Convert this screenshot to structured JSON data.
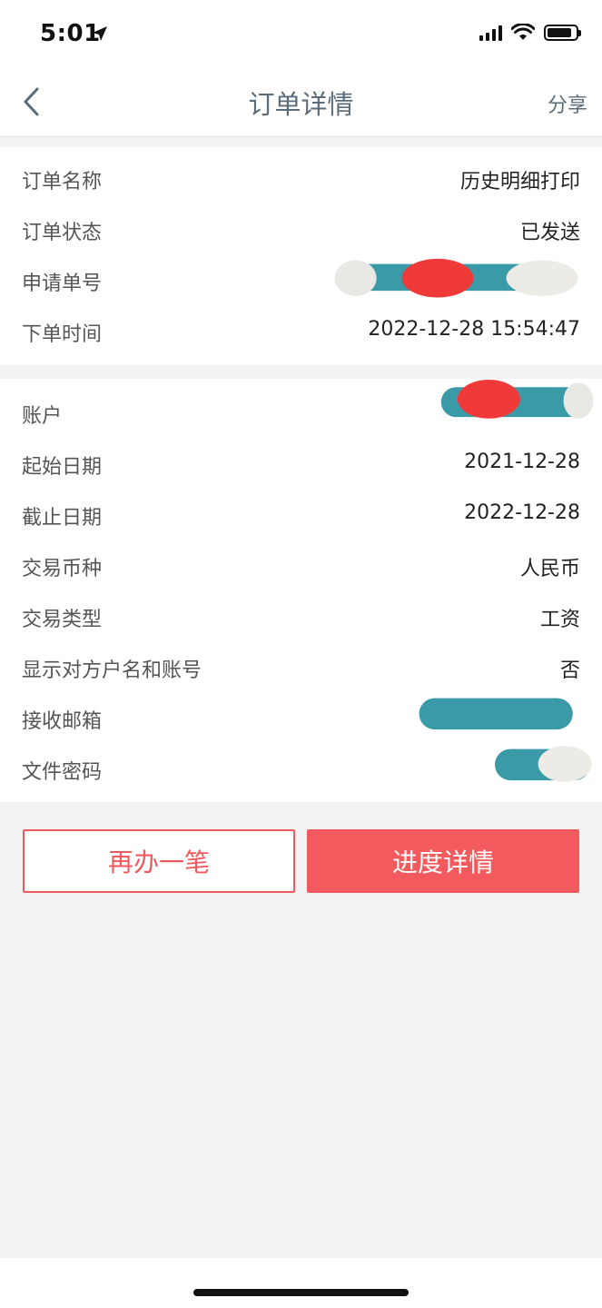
{
  "status_bar": {
    "time": "5:01",
    "location_icon": "location-arrow-icon",
    "signal_icon": "cellular-signal-icon",
    "wifi_icon": "wifi-icon",
    "battery_icon": "battery-icon"
  },
  "nav": {
    "back_icon": "chevron-left-icon",
    "title": "订单详情",
    "share_label": "分享"
  },
  "order_info": {
    "name_label": "订单名称",
    "name_value": "历史明细打印",
    "status_label": "订单状态",
    "status_value": "已发送",
    "apply_no_label": "申请单号",
    "time_label": "下单时间",
    "time_value": "2022-12-28 15:54:47"
  },
  "detail_info": {
    "account_label": "账户",
    "start_label": "起始日期",
    "start_value": "2021-12-28",
    "end_label": "截止日期",
    "end_value": "2022-12-28",
    "currency_label": "交易币种",
    "currency_value": "人民币",
    "type_label": "交易类型",
    "type_value": "工资",
    "show_counterparty_label": "显示对方户名和账号",
    "show_counterparty_value": "否",
    "email_label": "接收邮箱",
    "password_label": "文件密码"
  },
  "actions": {
    "redo_label": "再办一笔",
    "progress_label": "进度详情"
  },
  "colors": {
    "accent": "#f25a5d",
    "nav_text": "#5a6c7a",
    "redact_teal": "#3a9aa8",
    "redact_red": "#f03a3a"
  }
}
